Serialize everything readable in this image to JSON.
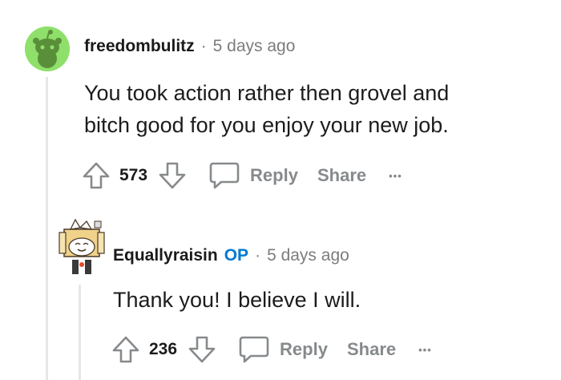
{
  "comments": [
    {
      "username": "freedombulitz",
      "separator": "·",
      "timestamp": "5 days ago",
      "body_line1": "You took action rather then grovel and",
      "body_line2": "bitch good for you enjoy your new job.",
      "votes": "573",
      "reply_label": "Reply",
      "share_label": "Share",
      "more_label": "•••",
      "avatar_color": "#8fe06b"
    },
    {
      "username": "Equallyraisin",
      "op_badge": "OP",
      "separator": "·",
      "timestamp": "5 days ago",
      "body": "Thank you! I believe I will.",
      "votes": "236",
      "reply_label": "Reply",
      "share_label": "Share",
      "more_label": "•••"
    }
  ],
  "colors": {
    "op_badge": "#0079d3",
    "muted": "#878a8c",
    "thread_line": "#e6e6e6"
  }
}
